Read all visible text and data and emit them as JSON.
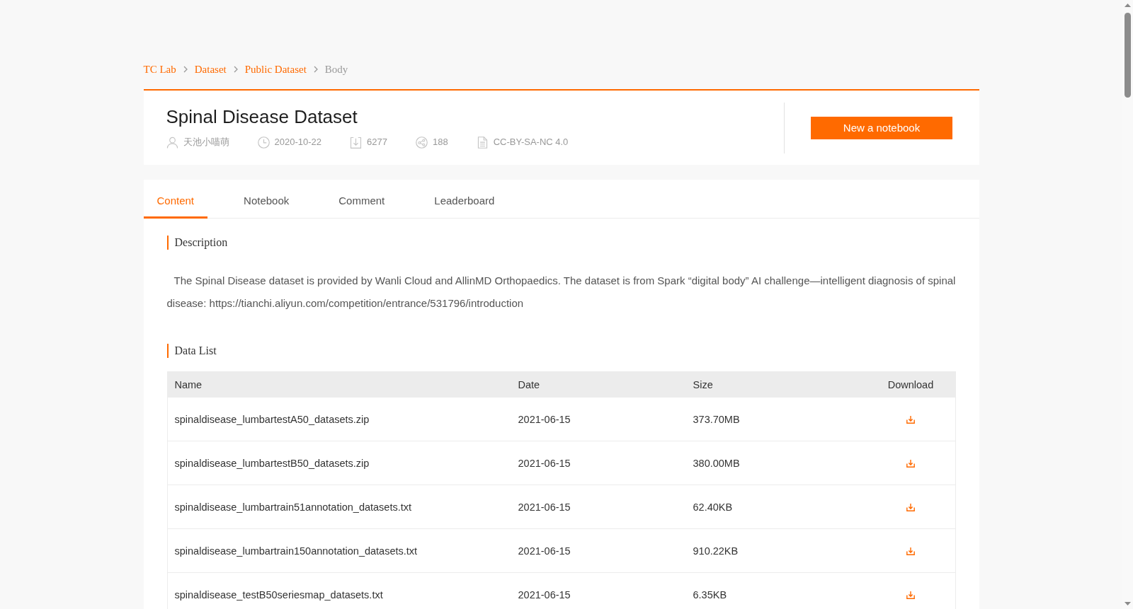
{
  "breadcrumb": [
    {
      "label": "TC Lab",
      "current": false
    },
    {
      "label": "Dataset",
      "current": false
    },
    {
      "label": "Public Dataset",
      "current": false
    },
    {
      "label": "Body",
      "current": true
    }
  ],
  "dataset": {
    "title": "Spinal Disease Dataset",
    "meta": [
      {
        "kind": "author",
        "text": "天池小喵萌"
      },
      {
        "kind": "date",
        "text": "2020-10-22"
      },
      {
        "kind": "downloads",
        "text": "6277"
      },
      {
        "kind": "shares",
        "text": "188"
      },
      {
        "kind": "license",
        "text": "CC-BY-SA-NC 4.0"
      }
    ],
    "action_button": "New a notebook"
  },
  "tabs": [
    {
      "label": "Content",
      "selected": true
    },
    {
      "label": "Notebook",
      "selected": false
    },
    {
      "label": "Comment",
      "selected": false
    },
    {
      "label": "Leaderboard",
      "selected": false
    }
  ],
  "description": {
    "heading": "Description",
    "text": "The Spinal Disease dataset is provided by Wanli Cloud and AllinMD Orthopaedics. The dataset is from Spark “digital body” AI challenge—intelligent diagnosis of spinal disease: https://tianchi.aliyun.com/competition/entrance/531796/introduction"
  },
  "data_list": {
    "heading": "Data List",
    "columns": [
      "Name",
      "Date",
      "Size",
      "Download"
    ],
    "rows": [
      {
        "name": "spinaldisease_lumbartestA50_datasets.zip",
        "date": "2021-06-15",
        "size": "373.70MB"
      },
      {
        "name": "spinaldisease_lumbartestB50_datasets.zip",
        "date": "2021-06-15",
        "size": "380.00MB"
      },
      {
        "name": "spinaldisease_lumbartrain51annotation_datasets.txt",
        "date": "2021-06-15",
        "size": "62.40KB"
      },
      {
        "name": "spinaldisease_lumbartrain150annotation_datasets.txt",
        "date": "2021-06-15",
        "size": "910.22KB"
      },
      {
        "name": "spinaldisease_testB50seriesmap_datasets.txt",
        "date": "2021-06-15",
        "size": "6.35KB"
      }
    ]
  }
}
